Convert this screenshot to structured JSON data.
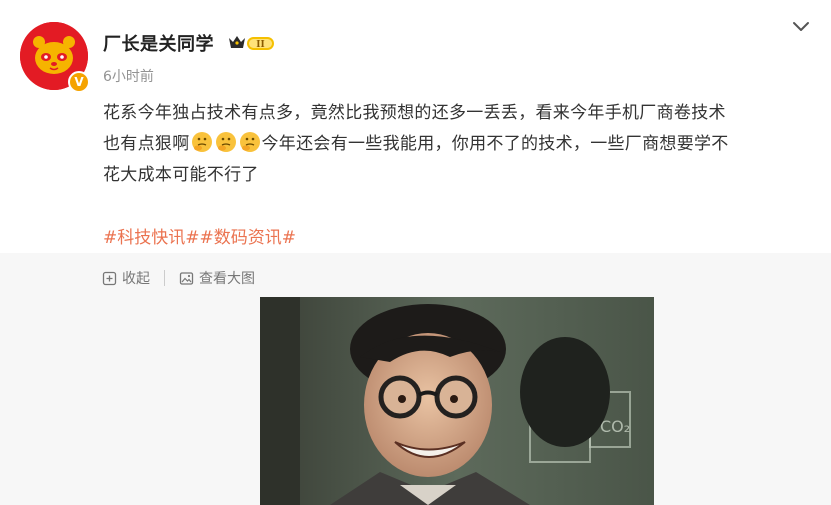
{
  "post": {
    "author": "厂长是关同学",
    "verified_badge": "V",
    "level_badge": "II",
    "time": "6小时前",
    "text_line1": "花系今年独占技术有点多，竟然比我预想的还多一丢丢，看来今年手机厂商卷技术",
    "text_line2_start": "也有点狠啊",
    "text_line2_end": "今年还会有一些我能用，你用不了的技术，一些厂商想要学不",
    "text_line3": "花大成本可能不行了",
    "tags": [
      "#科技快讯#",
      "#数码资讯#"
    ],
    "emoji": "thinking-emoji"
  },
  "toolbar": {
    "collapse_label": "收起",
    "view_large_label": "查看大图"
  },
  "photo": {
    "board_text": "CO₂"
  },
  "colors": {
    "accent": "#eb7350",
    "avatar_bg": "#e31b24",
    "verified": "#f5a300"
  }
}
